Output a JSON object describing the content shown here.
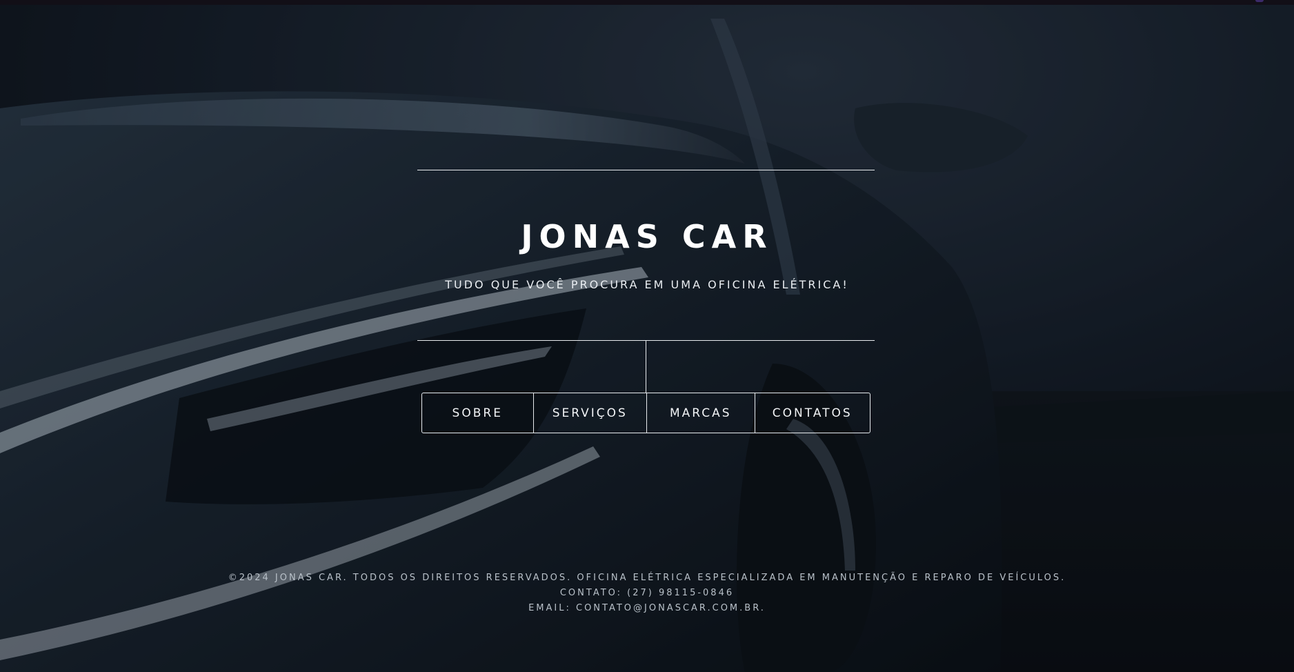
{
  "brand": {
    "title": "JONAS CAR",
    "tagline": "TUDO QUE VOCÊ PROCURA EM UMA OFICINA ELÉTRICA!"
  },
  "nav": {
    "items": [
      {
        "label": "SOBRE"
      },
      {
        "label": "SERVIÇOS"
      },
      {
        "label": "MARCAS"
      },
      {
        "label": "CONTATOS"
      }
    ]
  },
  "footer": {
    "copyright": "©2024 JONAS CAR. TODOS OS DIREITOS RESERVADOS. OFICINA ELÉTRICA ESPECIALIZADA EM MANUTENÇÃO E REPARO DE VEÍCULOS.",
    "contact": "CONTATO: (27) 98115-0846",
    "email": "EMAIL: CONTATO@JONASCAR.COM.BR."
  },
  "colors": {
    "background": "#0d1218",
    "text": "#ffffff",
    "rule": "#e8ebee",
    "footer_text": "#b9c1c9"
  },
  "icons": {
    "hero_image": "dark-sports-car-image"
  }
}
